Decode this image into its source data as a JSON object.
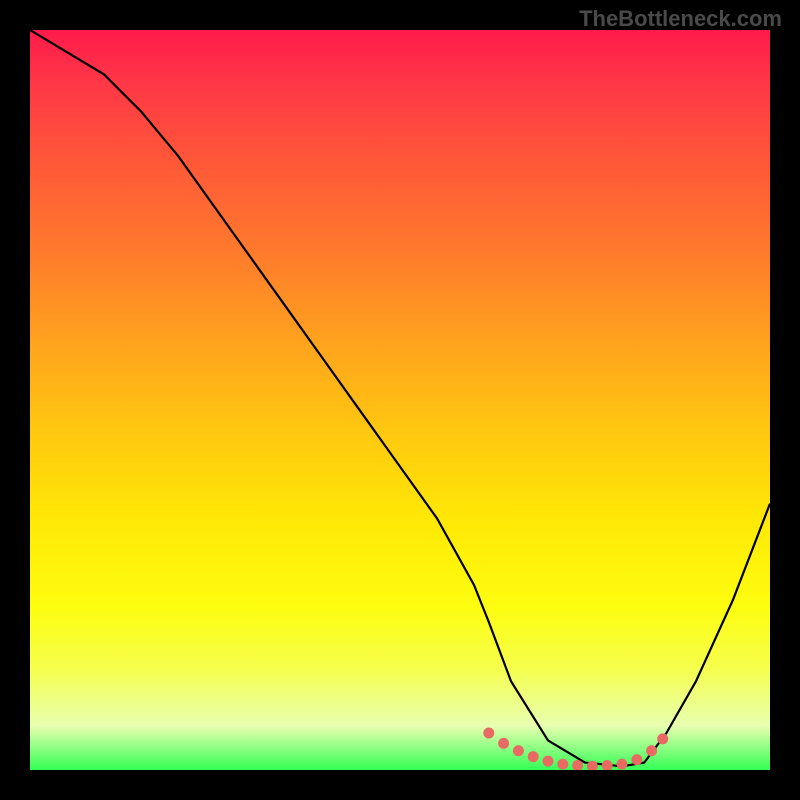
{
  "watermark": "TheBottleneck.com",
  "chart_data": {
    "type": "line",
    "title": "",
    "xlabel": "",
    "ylabel": "",
    "xlim": [
      0,
      100
    ],
    "ylim": [
      0,
      100
    ],
    "series": [
      {
        "name": "bottleneck-curve",
        "x": [
          0,
          5,
          10,
          15,
          20,
          25,
          30,
          35,
          40,
          45,
          50,
          55,
          60,
          62,
          65,
          70,
          75,
          80,
          83,
          86,
          90,
          95,
          100
        ],
        "values": [
          100,
          97,
          94,
          89,
          83,
          76,
          69,
          62,
          55,
          48,
          41,
          34,
          25,
          20,
          12,
          4,
          1,
          0.5,
          1,
          5,
          12,
          23,
          36
        ]
      }
    ],
    "markers": {
      "name": "recommended-range-dots",
      "x": [
        62,
        64,
        66,
        68,
        70,
        72,
        74,
        76,
        78,
        80,
        82,
        84,
        85.5
      ],
      "values": [
        5.0,
        3.6,
        2.6,
        1.8,
        1.2,
        0.8,
        0.6,
        0.5,
        0.6,
        0.8,
        1.4,
        2.6,
        4.2
      ]
    },
    "colors": {
      "curve": "#000000",
      "marker": "#e86a63"
    }
  }
}
